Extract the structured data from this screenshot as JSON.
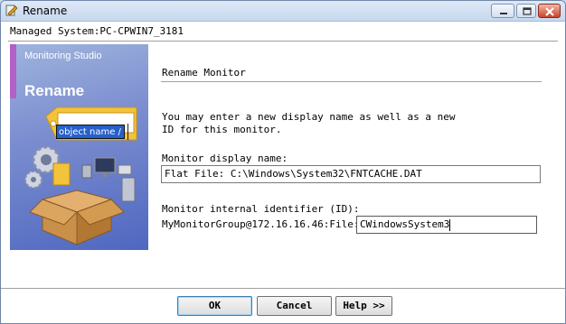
{
  "window": {
    "title": "Rename"
  },
  "managed_system": "Managed System:PC-CPWIN7_3181",
  "banner": {
    "product": "Monitoring Studio",
    "heading": "Rename",
    "tag_text": "object name / ID",
    "accent_color": "#b25fc8"
  },
  "section": {
    "heading": "Rename Monitor"
  },
  "instructions": "You may enter a new display name as well as a new\nID for this monitor.",
  "display_name": {
    "label": "Monitor display name:",
    "value": "Flat File: C:\\Windows\\System32\\FNTCACHE.DAT"
  },
  "internal_id": {
    "label": "Monitor internal identifier (ID):",
    "prefix": "MyMonitorGroup@172.16.16.46:File:",
    "value": "CWindowsSystem3"
  },
  "buttons": {
    "ok": "OK",
    "cancel": "Cancel",
    "help": "Help >>"
  }
}
